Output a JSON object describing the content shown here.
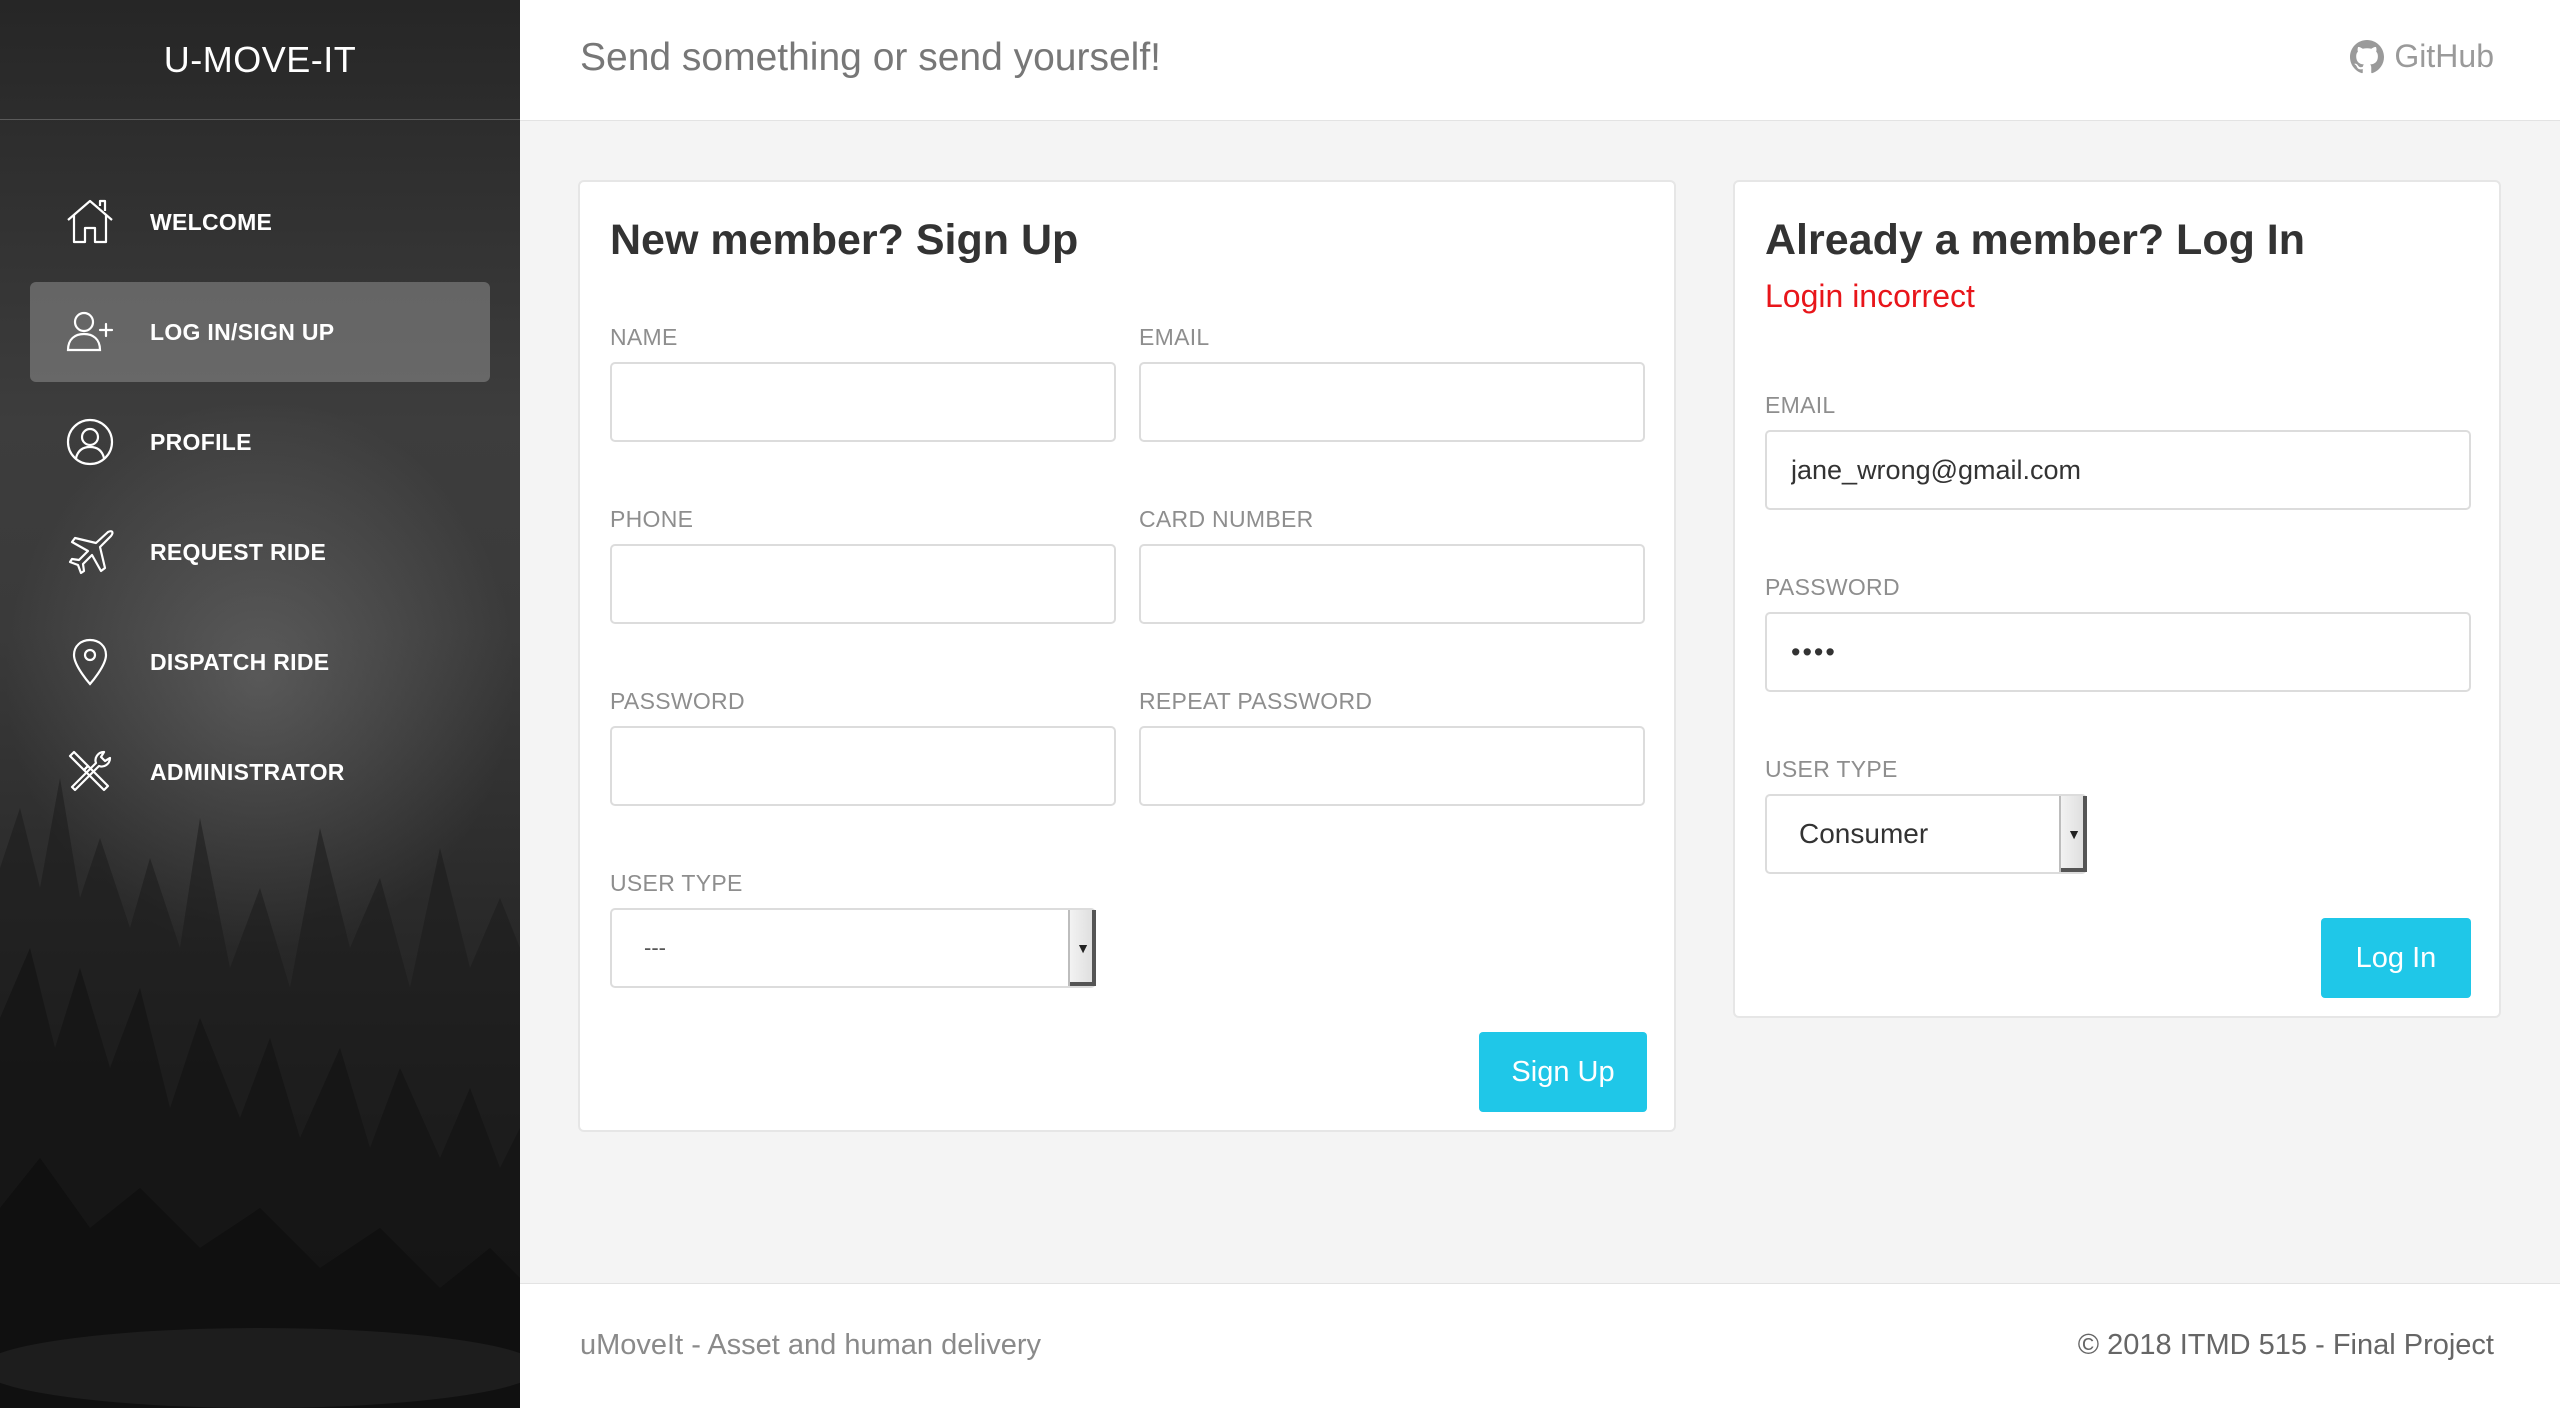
{
  "sidebar": {
    "brand": "U-MOVE-IT",
    "items": [
      {
        "label": "WELCOME",
        "icon": "home-icon",
        "active": false
      },
      {
        "label": "LOG IN/SIGN UP",
        "icon": "user-add-icon",
        "active": true
      },
      {
        "label": "PROFILE",
        "icon": "user-circle-icon",
        "active": false
      },
      {
        "label": "REQUEST RIDE",
        "icon": "airplane-icon",
        "active": false
      },
      {
        "label": "DISPATCH RIDE",
        "icon": "map-pin-icon",
        "active": false
      },
      {
        "label": "ADMINISTRATOR",
        "icon": "tools-icon",
        "active": false
      }
    ]
  },
  "header": {
    "title": "Send something or send yourself!",
    "github_label": "GitHub"
  },
  "signup": {
    "title": "New member? Sign Up",
    "fields": {
      "name": {
        "label": "NAME",
        "value": ""
      },
      "email": {
        "label": "EMAIL",
        "value": ""
      },
      "phone": {
        "label": "PHONE",
        "value": ""
      },
      "card_number": {
        "label": "CARD NUMBER",
        "value": ""
      },
      "password": {
        "label": "PASSWORD",
        "value": ""
      },
      "repeat_password": {
        "label": "REPEAT PASSWORD",
        "value": ""
      }
    },
    "user_type": {
      "label": "USER TYPE",
      "selected": "---"
    },
    "submit_label": "Sign Up"
  },
  "login": {
    "title": "Already a member? Log In",
    "error": "Login incorrect",
    "email": {
      "label": "EMAIL",
      "value": "jane_wrong@gmail.com"
    },
    "password": {
      "label": "PASSWORD",
      "value": "••••"
    },
    "user_type": {
      "label": "USER TYPE",
      "selected": "Consumer"
    },
    "submit_label": "Log In"
  },
  "footer": {
    "left": "uMoveIt - Asset and human delivery",
    "right": "© 2018 ITMD 515 - Final Project"
  },
  "colors": {
    "accent": "#1fc7e8",
    "error": "#e8151a",
    "sidebar_bg": "#2e2e2e"
  }
}
